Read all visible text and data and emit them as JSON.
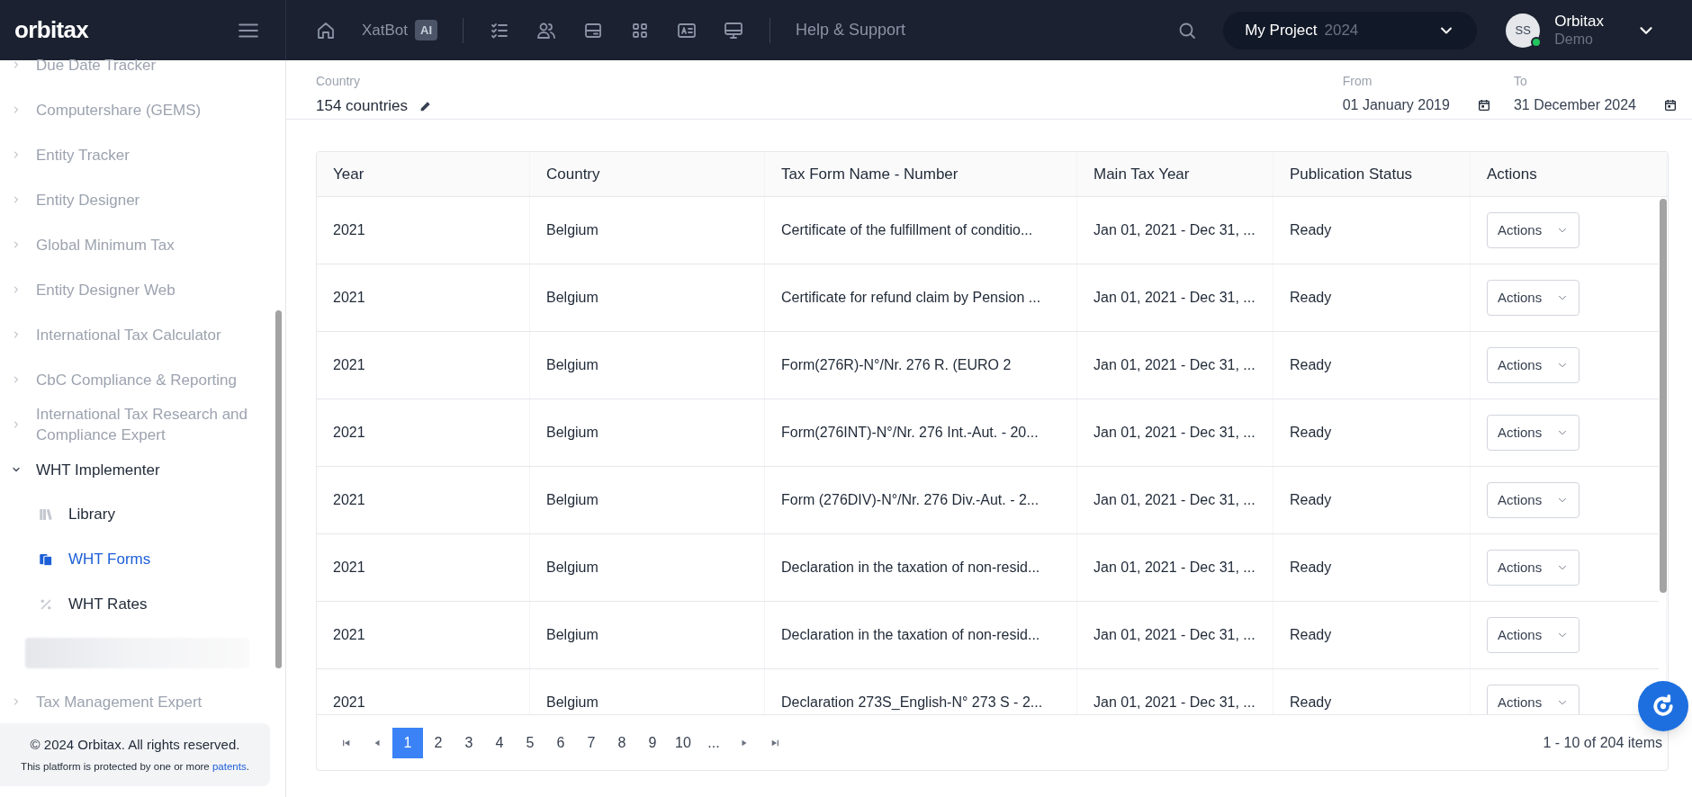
{
  "brand": {
    "logo": "orbitax"
  },
  "topbar": {
    "xatbot": "XatBot",
    "ai_badge": "AI",
    "help": "Help & Support",
    "project": {
      "name": "My Project",
      "year": "2024"
    },
    "user": {
      "initials": "SS",
      "name": "Orbitax",
      "subtitle": "Demo"
    }
  },
  "sidebar": {
    "items": [
      {
        "label": "Due Date Tracker",
        "expanded": false
      },
      {
        "label": "Computershare (GEMS)",
        "expanded": false
      },
      {
        "label": "Entity Tracker",
        "expanded": false
      },
      {
        "label": "Entity Designer",
        "expanded": false
      },
      {
        "label": "Global Minimum Tax",
        "expanded": false
      },
      {
        "label": "Entity Designer Web",
        "expanded": false
      },
      {
        "label": "International Tax Calculator",
        "expanded": false
      },
      {
        "label": "CbC Compliance & Reporting",
        "expanded": false
      },
      {
        "label": "International Tax Research and Compliance Expert",
        "expanded": false
      },
      {
        "label": "WHT Implementer",
        "expanded": true,
        "children": [
          {
            "label": "Library",
            "kind": "library",
            "selected": false
          },
          {
            "label": "WHT Forms",
            "kind": "forms",
            "selected": true
          },
          {
            "label": "WHT Rates",
            "kind": "rates",
            "selected": false
          }
        ]
      },
      {
        "label": "Tax Management Expert",
        "expanded": false
      }
    ],
    "footer": {
      "copyright": "© 2024 Orbitax. All rights reserved.",
      "notice": "This platform is protected by one or more",
      "link": "patents",
      "period": "."
    }
  },
  "filters": {
    "country_label": "Country",
    "country_value": "154 countries",
    "from_label": "From",
    "from_value": "01 January 2019",
    "to_label": "To",
    "to_value": "31 December 2024"
  },
  "table": {
    "columns": [
      "Year",
      "Country",
      "Tax Form Name - Number",
      "Main Tax Year",
      "Publication Status",
      "Actions"
    ],
    "rows": [
      [
        "2021",
        "Belgium",
        "Certificate of the fulfillment of conditio...",
        "Jan 01, 2021 - Dec 31, ...",
        "Ready",
        "Actions"
      ],
      [
        "2021",
        "Belgium",
        "Certificate for refund claim by Pension ...",
        "Jan 01, 2021 - Dec 31, ...",
        "Ready",
        "Actions"
      ],
      [
        "2021",
        "Belgium",
        "Form(276R)-N°/Nr. 276 R. (EURO 2",
        "Jan 01, 2021 - Dec 31, ...",
        "Ready",
        "Actions"
      ],
      [
        "2021",
        "Belgium",
        "Form(276INT)-N°/Nr. 276 Int.-Aut. - 20...",
        "Jan 01, 2021 - Dec 31, ...",
        "Ready",
        "Actions"
      ],
      [
        "2021",
        "Belgium",
        "Form (276DIV)-N°/Nr. 276 Div.-Aut. - 2...",
        "Jan 01, 2021 - Dec 31, ...",
        "Ready",
        "Actions"
      ],
      [
        "2021",
        "Belgium",
        "Declaration in the taxation of non-resid...",
        "Jan 01, 2021 - Dec 31, ...",
        "Ready",
        "Actions"
      ],
      [
        "2021",
        "Belgium",
        "Declaration in the taxation of non-resid...",
        "Jan 01, 2021 - Dec 31, ...",
        "Ready",
        "Actions"
      ],
      [
        "2021",
        "Belgium",
        "Declaration 273S_English-N° 273 S - 2...",
        "Jan 01, 2021 - Dec 31, ...",
        "Ready",
        "Actions"
      ]
    ],
    "pages": [
      {
        "label": "1",
        "selected": true
      },
      {
        "label": "2",
        "selected": false
      },
      {
        "label": "3",
        "selected": false
      },
      {
        "label": "4",
        "selected": false
      },
      {
        "label": "5",
        "selected": false
      },
      {
        "label": "6",
        "selected": false
      },
      {
        "label": "7",
        "selected": false
      },
      {
        "label": "8",
        "selected": false
      },
      {
        "label": "9",
        "selected": false
      },
      {
        "label": "10",
        "selected": false
      },
      {
        "label": "...",
        "selected": false
      }
    ],
    "summary": "1 - 10 of 204 items"
  }
}
